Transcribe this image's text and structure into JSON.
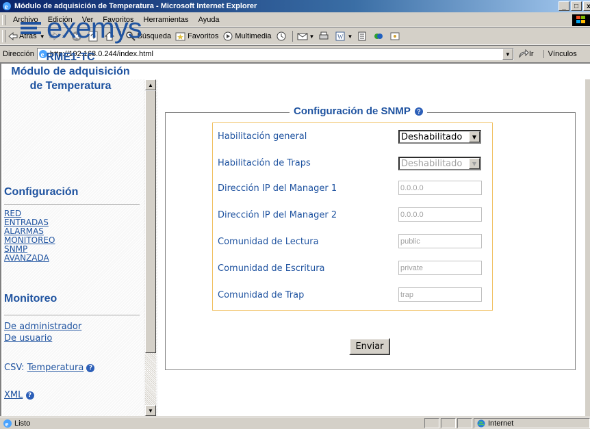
{
  "window": {
    "title": "Módulo de adquisición de Temperatura - Microsoft Internet Explorer",
    "minimize": "_",
    "maximize": "□",
    "close": "x"
  },
  "menu": [
    "Archivo",
    "Edición",
    "Ver",
    "Favoritos",
    "Herramientas",
    "Ayuda"
  ],
  "toolbar": {
    "back": "Atrás",
    "search": "Búsqueda",
    "favorites": "Favoritos",
    "multimedia": "Multimedia"
  },
  "address": {
    "label": "Dirección",
    "url": "http://192.168.0.244/index.html",
    "go": "Ir",
    "links": "Vínculos"
  },
  "sidebar": {
    "logo": "exemys",
    "device_lines": [
      "RME1-TC",
      "Módulo de adquisición",
      "de Temperatura"
    ],
    "config_title": "Configuración",
    "config_links": [
      "RED",
      "ENTRADAS",
      "ALARMAS",
      "MONITOREO",
      "SNMP",
      "AVANZADA"
    ],
    "monitor_title": "Monitoreo",
    "monitor_links": [
      "De administrador",
      "De usuario"
    ],
    "csv_label": "CSV:",
    "csv_link": "Temperatura",
    "xml_link": "XML"
  },
  "form": {
    "title": "Configuración de SNMP",
    "fields": [
      {
        "label": "Habilitación general",
        "type": "select",
        "value": "Deshabilitado",
        "enabled": true
      },
      {
        "label": "Habilitación de Traps",
        "type": "select",
        "value": "Deshabilitado",
        "enabled": false
      },
      {
        "label": "Dirección IP del Manager 1",
        "type": "input",
        "value": "0.0.0.0"
      },
      {
        "label": "Dirección IP del Manager 2",
        "type": "input",
        "value": "0.0.0.0"
      },
      {
        "label": "Comunidad de Lectura",
        "type": "input",
        "value": "public"
      },
      {
        "label": "Comunidad de Escritura",
        "type": "input",
        "value": "private"
      },
      {
        "label": "Comunidad de Trap",
        "type": "input",
        "value": "trap"
      }
    ],
    "submit": "Enviar"
  },
  "status": {
    "text": "Listo",
    "zone": "Internet"
  },
  "colors": {
    "brand": "#1f53a0",
    "form_border": "#f0c060",
    "titlebar": "#0a246a"
  }
}
